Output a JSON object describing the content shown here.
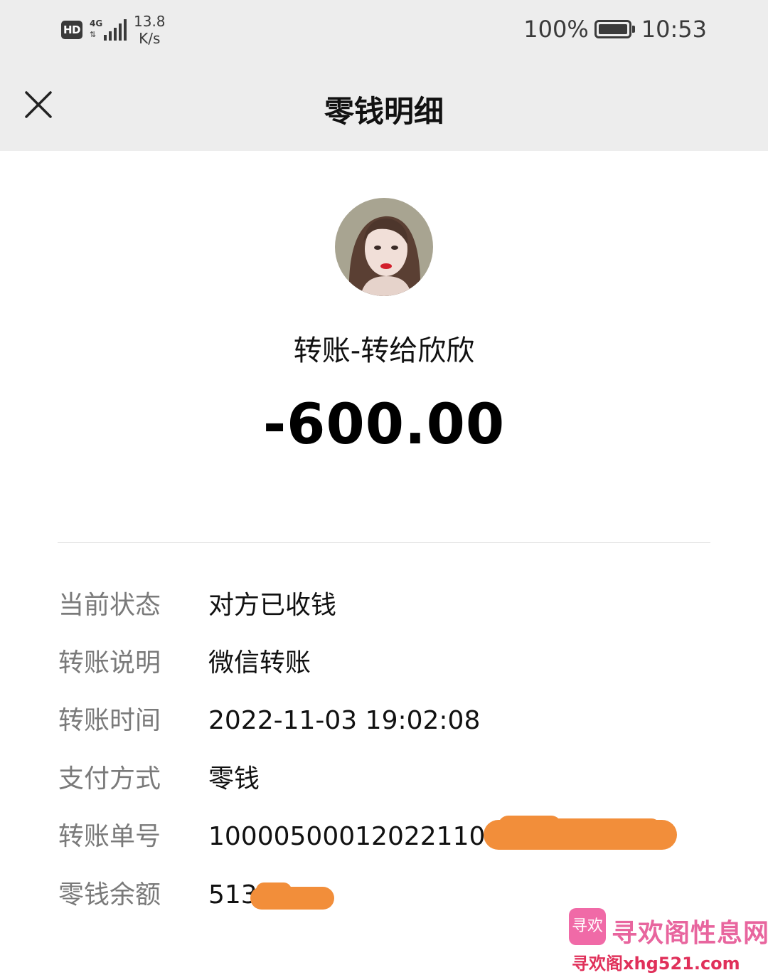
{
  "status_bar": {
    "hd": "HD",
    "network": "4G",
    "net_speed_value": "13.8",
    "net_speed_unit": "K/s",
    "battery": "100%",
    "time": "10:53"
  },
  "nav": {
    "title": "零钱明细"
  },
  "transaction": {
    "title": "转账-转给欣欣",
    "amount": "-600.00"
  },
  "details": [
    {
      "label": "当前状态",
      "value": "对方已收钱"
    },
    {
      "label": "转账说明",
      "value": "微信转账"
    },
    {
      "label": "转账时间",
      "value": "2022-11-03 19:02:08"
    },
    {
      "label": "支付方式",
      "value": "零钱"
    },
    {
      "label": "转账单号",
      "value": "10000500012022110З"
    },
    {
      "label": "零钱余额",
      "value": "513"
    }
  ],
  "watermark": {
    "logo_text": "寻欢",
    "site_name": "寻欢阁性息网",
    "url": "寻欢阁xhg521.com"
  },
  "colors": {
    "top_bar": "#ededed",
    "label_gray": "#7a7a7a",
    "redaction_orange": "#f28e3a"
  }
}
